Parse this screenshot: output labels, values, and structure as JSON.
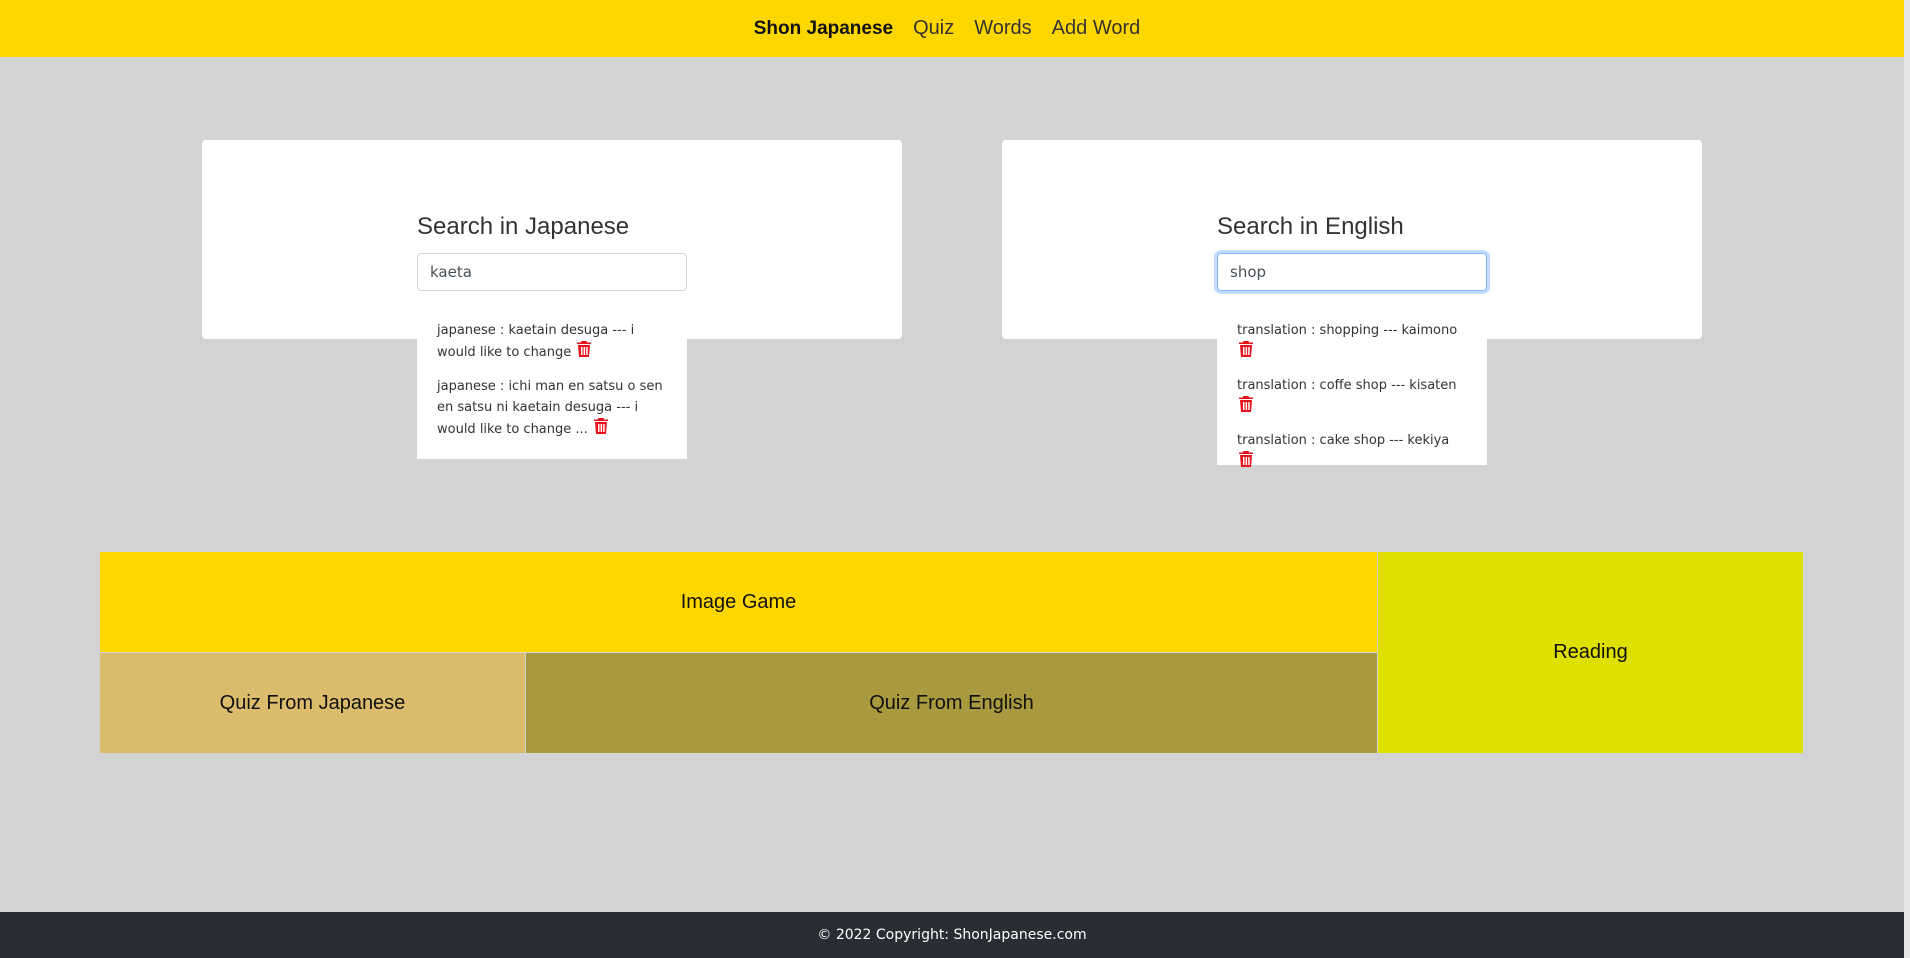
{
  "navbar": {
    "brand": "Shon Japanese",
    "links": [
      "Quiz",
      "Words",
      "Add Word"
    ],
    "background": "#ffd700"
  },
  "search_japanese": {
    "title": "Search in Japanese",
    "value": "kaeta",
    "results": [
      "japanese : kaetain desuga --- i would like to change",
      "japanese : ichi man en satsu o sen en satsu ni kaetain desuga --- i would like to change ..."
    ]
  },
  "search_english": {
    "title": "Search in English",
    "value": "shop",
    "results": [
      "translation : shopping --- kaimono",
      "translation : coffe shop --- kisaten",
      "translation : cake shop --- kekiya"
    ]
  },
  "tiles": {
    "image_game": "Image Game",
    "reading": "Reading",
    "quiz_from_japanese": "Quiz From Japanese",
    "quiz_from_english": "Quiz From English"
  },
  "footer": {
    "text": "© 2022 Copyright: ShonJapanese.com"
  },
  "colors": {
    "page_bg": "#d3d3d3",
    "trash_icon": "#e8111a",
    "footer_bg": "#2a2d33"
  },
  "icons": {
    "delete": "trash-icon"
  }
}
